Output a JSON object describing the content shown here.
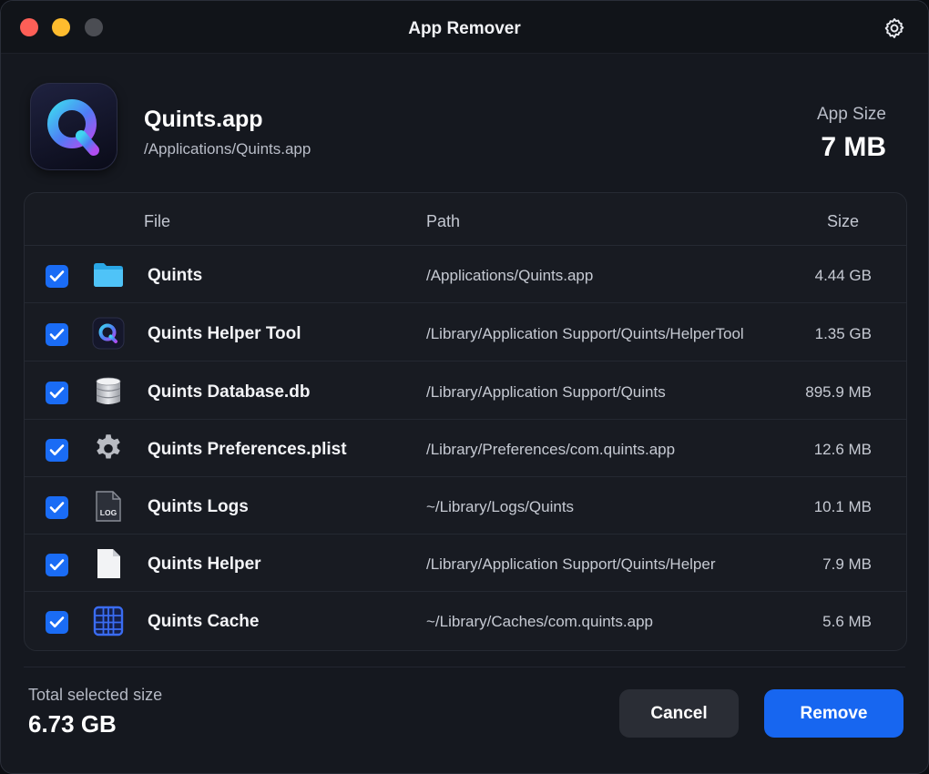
{
  "window": {
    "title": "App Remover"
  },
  "app": {
    "name": "Quints.app",
    "path": "/Applications/Quints.app",
    "size_label": "App Size",
    "size_value": "7 MB",
    "icon": "quints-logo-icon"
  },
  "table": {
    "headers": {
      "file": "File",
      "path": "Path",
      "size": "Size"
    },
    "rows": [
      {
        "checked": true,
        "icon": "folder-icon",
        "name": "Quints",
        "path": "/Applications/Quints.app",
        "size": "4.44 GB"
      },
      {
        "checked": true,
        "icon": "quints-helper-icon",
        "name": "Quints Helper Tool",
        "path": "/Library/Application Support/Quints/HelperTool",
        "size": "1.35 GB"
      },
      {
        "checked": true,
        "icon": "database-icon",
        "name": "Quints Database.db",
        "path": "/Library/Application Support/Quints",
        "size": "895.9 MB"
      },
      {
        "checked": true,
        "icon": "gear-file-icon",
        "name": "Quints Preferences.plist",
        "path": "/Library/Preferences/com.quints.app",
        "size": "12.6 MB"
      },
      {
        "checked": true,
        "icon": "log-file-icon",
        "name": "Quints Logs",
        "path": "~/Library/Logs/Quints",
        "size": "10.1 MB",
        "icon_text": "LOG"
      },
      {
        "checked": true,
        "icon": "document-icon",
        "name": "Quints Helper",
        "path": "/Library/Application Support/Quints/Helper",
        "size": "7.9 MB"
      },
      {
        "checked": true,
        "icon": "cache-grid-icon",
        "name": "Quints Cache",
        "path": "~/Library/Caches/com.quints.app",
        "size": "5.6 MB"
      }
    ]
  },
  "footer": {
    "total_label": "Total selected size",
    "total_value": "6.73 GB",
    "cancel_label": "Cancel",
    "remove_label": "Remove"
  },
  "colors": {
    "accent": "#1766f0",
    "checkbox": "#1a6cf5",
    "background": "#15181f"
  }
}
